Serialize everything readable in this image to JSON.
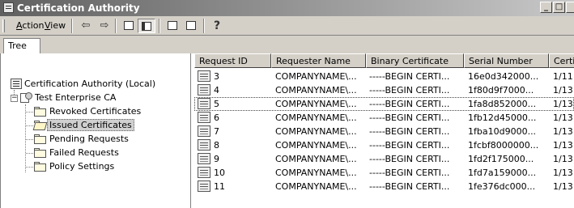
{
  "window": {
    "title": "Certification Authority",
    "min": "_",
    "max": "□"
  },
  "menu": {
    "action_u": "A",
    "action_rest": "ction",
    "view_u": "V",
    "view_rest": "iew"
  },
  "toolbar": {
    "back": "⇦",
    "forward": "⇨"
  },
  "tree": {
    "tab_label": "Tree",
    "root": "Certification Authority (Local)",
    "ca": "Test Enterprise CA",
    "expander": "−",
    "items": [
      "Revoked Certificates",
      "Issued Certificates",
      "Pending Requests",
      "Failed Requests",
      "Policy Settings"
    ]
  },
  "list": {
    "columns": [
      "Request ID",
      "Requester Name",
      "Binary Certificate",
      "Serial Number",
      "Certi"
    ],
    "rows": [
      {
        "id": "3",
        "name": "COMPANYNAME\\...",
        "bin": "-----BEGIN CERTI...",
        "serial": "16e0d342000...",
        "date": "1/11"
      },
      {
        "id": "4",
        "name": "COMPANYNAME\\...",
        "bin": "-----BEGIN CERTI...",
        "serial": "1f80d9f7000...",
        "date": "1/13"
      },
      {
        "id": "5",
        "name": "COMPANYNAME\\...",
        "bin": "-----BEGIN CERTI...",
        "serial": "1fa8d852000...",
        "date": "1/13"
      },
      {
        "id": "6",
        "name": "COMPANYNAME\\...",
        "bin": "-----BEGIN CERTI...",
        "serial": "1fb12d45000...",
        "date": "1/13"
      },
      {
        "id": "7",
        "name": "COMPANYNAME\\...",
        "bin": "-----BEGIN CERTI...",
        "serial": "1fba10d9000...",
        "date": "1/13"
      },
      {
        "id": "8",
        "name": "COMPANYNAME\\...",
        "bin": "-----BEGIN CERTI...",
        "serial": "1fcbf8000000...",
        "date": "1/13"
      },
      {
        "id": "9",
        "name": "COMPANYNAME\\...",
        "bin": "-----BEGIN CERTI...",
        "serial": "1fd2f175000...",
        "date": "1/13"
      },
      {
        "id": "10",
        "name": "COMPANYNAME\\...",
        "bin": "-----BEGIN CERTI...",
        "serial": "1fd7a159000...",
        "date": "1/13"
      },
      {
        "id": "11",
        "name": "COMPANYNAME\\...",
        "bin": "-----BEGIN CERTI...",
        "serial": "1fe376dc000...",
        "date": "1/13"
      }
    ]
  }
}
